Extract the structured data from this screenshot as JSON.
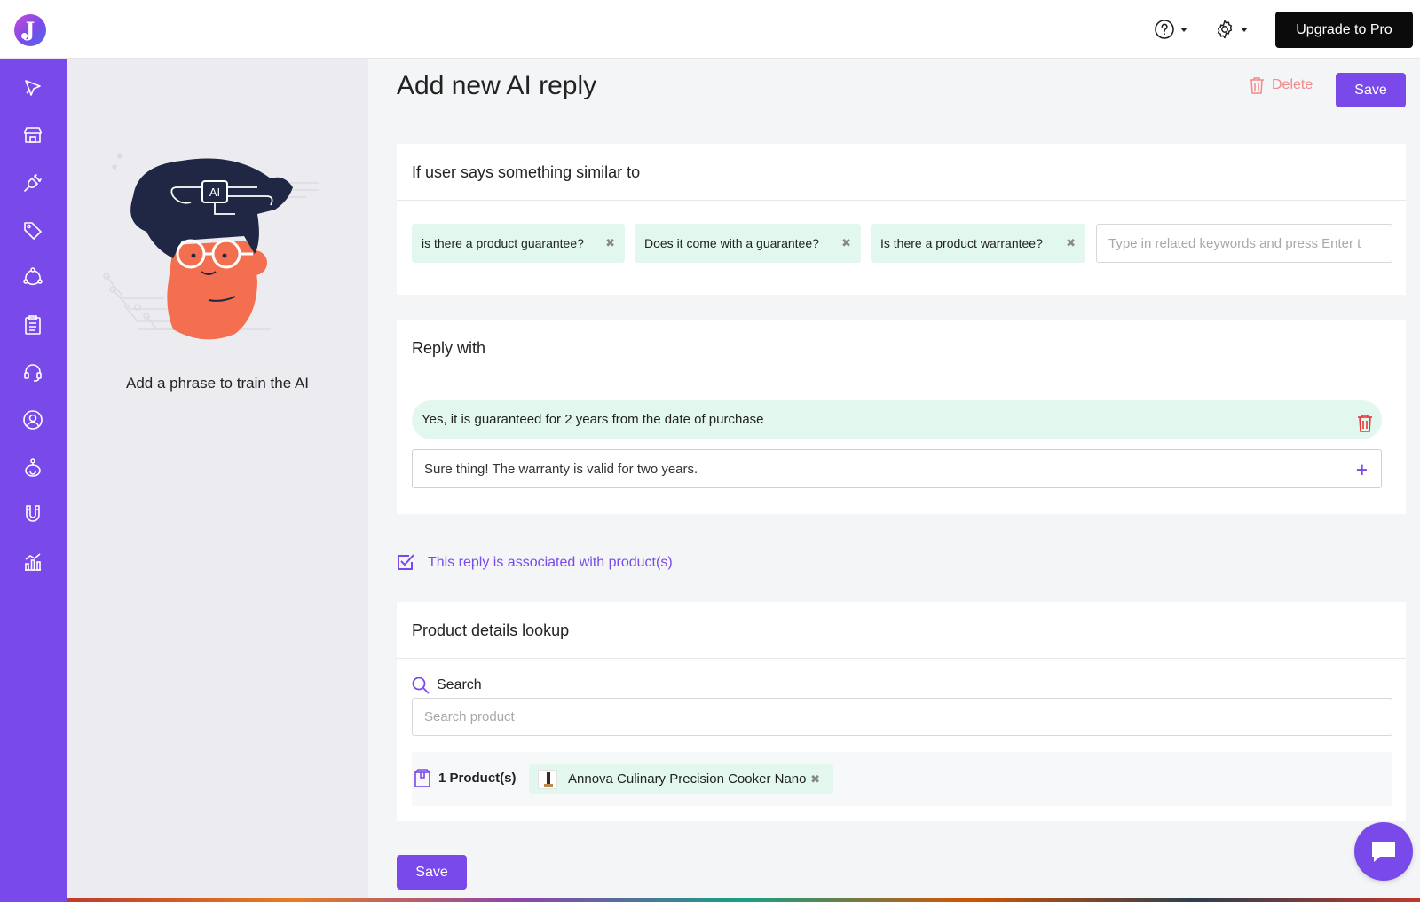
{
  "header": {
    "logo_letter": "J",
    "help_icon": "help-icon",
    "settings_icon": "gear-icon",
    "upgrade_label": "Upgrade to Pro"
  },
  "sidebar": {
    "expand_icon": "double-chevron-right-icon",
    "items": [
      {
        "icon": "rocket-icon"
      },
      {
        "icon": "store-icon"
      },
      {
        "icon": "plug-icon"
      },
      {
        "icon": "tag-icon"
      },
      {
        "icon": "workflow-icon"
      },
      {
        "icon": "clipboard-icon"
      },
      {
        "icon": "headset-icon"
      },
      {
        "icon": "user-circle-icon"
      },
      {
        "icon": "bot-icon"
      },
      {
        "icon": "magnet-icon"
      },
      {
        "icon": "analytics-icon"
      }
    ]
  },
  "illustration": {
    "badge": "AI",
    "caption": "Add a phrase to train the AI"
  },
  "page": {
    "title": "Add new AI reply",
    "delete_label": "Delete",
    "save_label": "Save"
  },
  "similar": {
    "heading": "If user says something similar to",
    "phrases": [
      "is there a product guarantee?",
      "Does it come with a guarantee?",
      "Is there a product warrantee?"
    ],
    "input_placeholder": "Type in related keywords and press Enter t"
  },
  "reply": {
    "heading": "Reply with",
    "existing": "Yes, it is guaranteed for 2 years from the date of purchase",
    "input_value": "Sure thing! The warranty is valid for two years."
  },
  "association": {
    "checked": true,
    "label": "This reply is associated with product(s)"
  },
  "lookup": {
    "heading": "Product details lookup",
    "search_label": "Search",
    "search_placeholder": "Search product",
    "count_label": "1 Product(s)",
    "products": [
      "Annova Culinary Precision Cooker Nano"
    ]
  },
  "footer": {
    "save_label": "Save"
  },
  "colors": {
    "accent": "#7a49ea",
    "chip_bg": "#e2f8ef",
    "delete": "#f08a8a",
    "upgrade_bg": "#0b0b0b"
  }
}
